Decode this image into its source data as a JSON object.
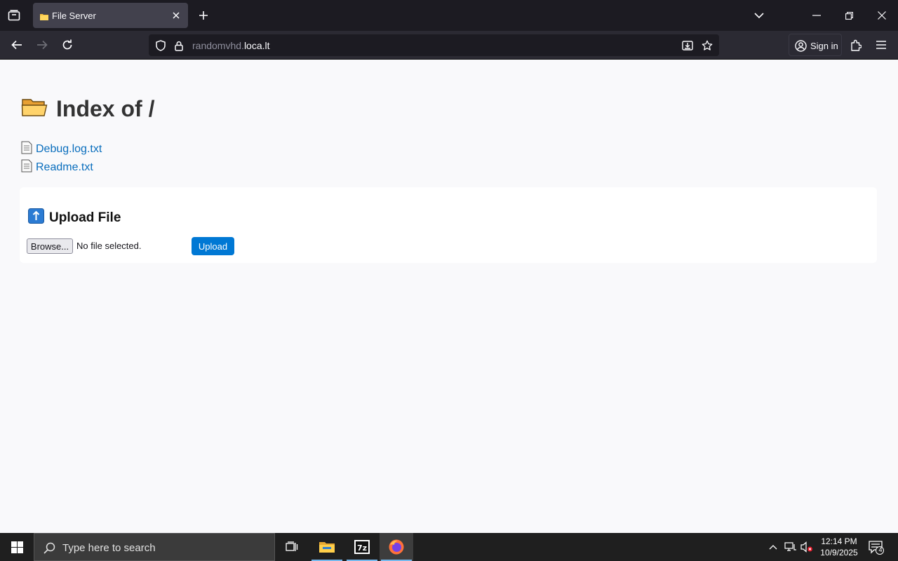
{
  "browser": {
    "tab": {
      "title": "File Server"
    },
    "url": {
      "prefix": "randomvhd.",
      "domain": "loca.lt"
    },
    "signin_label": "Sign in"
  },
  "page": {
    "title": "Index of /",
    "files": [
      {
        "name": "Debug.log.txt"
      },
      {
        "name": "Readme.txt"
      }
    ],
    "upload": {
      "heading": "Upload File",
      "browse_label": "Browse...",
      "file_status": "No file selected.",
      "submit_label": "Upload"
    }
  },
  "taskbar": {
    "search_placeholder": "Type here to search",
    "time": "12:14 PM",
    "date": "10/9/2025",
    "notification_count": "4"
  },
  "colors": {
    "link": "#0a6ebd",
    "upload_button": "#0078d4",
    "chrome_dark": "#1c1b22",
    "taskbar": "#1f1f1f"
  }
}
